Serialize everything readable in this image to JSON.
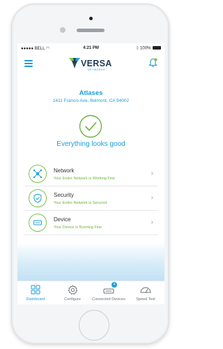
{
  "status_bar": {
    "carrier": "BELL",
    "time": "4:21 PM",
    "battery": "100%"
  },
  "header": {
    "logo_name": "VERSA",
    "logo_sub": "NETWORKS"
  },
  "site": {
    "name": "Atlases",
    "address": "1411 Francis Ave, Belmont, CA 94002"
  },
  "overall_status": "Everything looks good",
  "cards": [
    {
      "title": "Network",
      "subtitle": "Your Entire Network is Working Fine"
    },
    {
      "title": "Security",
      "subtitle": "Your Entire Network is Secured"
    },
    {
      "title": "Device",
      "subtitle": "Your Device is Running Fine"
    }
  ],
  "tabs": [
    {
      "label": "Dashboard"
    },
    {
      "label": "Configure"
    },
    {
      "label": "Connected Devices",
      "badge": "4"
    },
    {
      "label": "Speed Test"
    }
  ],
  "colors": {
    "accent": "#1a9ed9",
    "ok_green": "#6ab43e",
    "logo_navy": "#1d3b57"
  }
}
